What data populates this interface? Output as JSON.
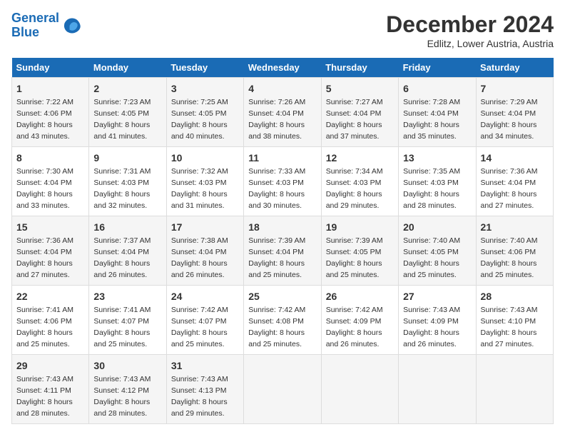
{
  "header": {
    "logo_line1": "General",
    "logo_line2": "Blue",
    "month": "December 2024",
    "location": "Edlitz, Lower Austria, Austria"
  },
  "weekdays": [
    "Sunday",
    "Monday",
    "Tuesday",
    "Wednesday",
    "Thursday",
    "Friday",
    "Saturday"
  ],
  "weeks": [
    [
      {
        "day": "1",
        "sunrise": "7:22 AM",
        "sunset": "4:06 PM",
        "daylight": "8 hours and 43 minutes."
      },
      {
        "day": "2",
        "sunrise": "7:23 AM",
        "sunset": "4:05 PM",
        "daylight": "8 hours and 41 minutes."
      },
      {
        "day": "3",
        "sunrise": "7:25 AM",
        "sunset": "4:05 PM",
        "daylight": "8 hours and 40 minutes."
      },
      {
        "day": "4",
        "sunrise": "7:26 AM",
        "sunset": "4:04 PM",
        "daylight": "8 hours and 38 minutes."
      },
      {
        "day": "5",
        "sunrise": "7:27 AM",
        "sunset": "4:04 PM",
        "daylight": "8 hours and 37 minutes."
      },
      {
        "day": "6",
        "sunrise": "7:28 AM",
        "sunset": "4:04 PM",
        "daylight": "8 hours and 35 minutes."
      },
      {
        "day": "7",
        "sunrise": "7:29 AM",
        "sunset": "4:04 PM",
        "daylight": "8 hours and 34 minutes."
      }
    ],
    [
      {
        "day": "8",
        "sunrise": "7:30 AM",
        "sunset": "4:04 PM",
        "daylight": "8 hours and 33 minutes."
      },
      {
        "day": "9",
        "sunrise": "7:31 AM",
        "sunset": "4:03 PM",
        "daylight": "8 hours and 32 minutes."
      },
      {
        "day": "10",
        "sunrise": "7:32 AM",
        "sunset": "4:03 PM",
        "daylight": "8 hours and 31 minutes."
      },
      {
        "day": "11",
        "sunrise": "7:33 AM",
        "sunset": "4:03 PM",
        "daylight": "8 hours and 30 minutes."
      },
      {
        "day": "12",
        "sunrise": "7:34 AM",
        "sunset": "4:03 PM",
        "daylight": "8 hours and 29 minutes."
      },
      {
        "day": "13",
        "sunrise": "7:35 AM",
        "sunset": "4:03 PM",
        "daylight": "8 hours and 28 minutes."
      },
      {
        "day": "14",
        "sunrise": "7:36 AM",
        "sunset": "4:04 PM",
        "daylight": "8 hours and 27 minutes."
      }
    ],
    [
      {
        "day": "15",
        "sunrise": "7:36 AM",
        "sunset": "4:04 PM",
        "daylight": "8 hours and 27 minutes."
      },
      {
        "day": "16",
        "sunrise": "7:37 AM",
        "sunset": "4:04 PM",
        "daylight": "8 hours and 26 minutes."
      },
      {
        "day": "17",
        "sunrise": "7:38 AM",
        "sunset": "4:04 PM",
        "daylight": "8 hours and 26 minutes."
      },
      {
        "day": "18",
        "sunrise": "7:39 AM",
        "sunset": "4:04 PM",
        "daylight": "8 hours and 25 minutes."
      },
      {
        "day": "19",
        "sunrise": "7:39 AM",
        "sunset": "4:05 PM",
        "daylight": "8 hours and 25 minutes."
      },
      {
        "day": "20",
        "sunrise": "7:40 AM",
        "sunset": "4:05 PM",
        "daylight": "8 hours and 25 minutes."
      },
      {
        "day": "21",
        "sunrise": "7:40 AM",
        "sunset": "4:06 PM",
        "daylight": "8 hours and 25 minutes."
      }
    ],
    [
      {
        "day": "22",
        "sunrise": "7:41 AM",
        "sunset": "4:06 PM",
        "daylight": "8 hours and 25 minutes."
      },
      {
        "day": "23",
        "sunrise": "7:41 AM",
        "sunset": "4:07 PM",
        "daylight": "8 hours and 25 minutes."
      },
      {
        "day": "24",
        "sunrise": "7:42 AM",
        "sunset": "4:07 PM",
        "daylight": "8 hours and 25 minutes."
      },
      {
        "day": "25",
        "sunrise": "7:42 AM",
        "sunset": "4:08 PM",
        "daylight": "8 hours and 25 minutes."
      },
      {
        "day": "26",
        "sunrise": "7:42 AM",
        "sunset": "4:09 PM",
        "daylight": "8 hours and 26 minutes."
      },
      {
        "day": "27",
        "sunrise": "7:43 AM",
        "sunset": "4:09 PM",
        "daylight": "8 hours and 26 minutes."
      },
      {
        "day": "28",
        "sunrise": "7:43 AM",
        "sunset": "4:10 PM",
        "daylight": "8 hours and 27 minutes."
      }
    ],
    [
      {
        "day": "29",
        "sunrise": "7:43 AM",
        "sunset": "4:11 PM",
        "daylight": "8 hours and 28 minutes."
      },
      {
        "day": "30",
        "sunrise": "7:43 AM",
        "sunset": "4:12 PM",
        "daylight": "8 hours and 28 minutes."
      },
      {
        "day": "31",
        "sunrise": "7:43 AM",
        "sunset": "4:13 PM",
        "daylight": "8 hours and 29 minutes."
      },
      null,
      null,
      null,
      null
    ]
  ],
  "labels": {
    "sunrise": "Sunrise:",
    "sunset": "Sunset:",
    "daylight": "Daylight:"
  }
}
